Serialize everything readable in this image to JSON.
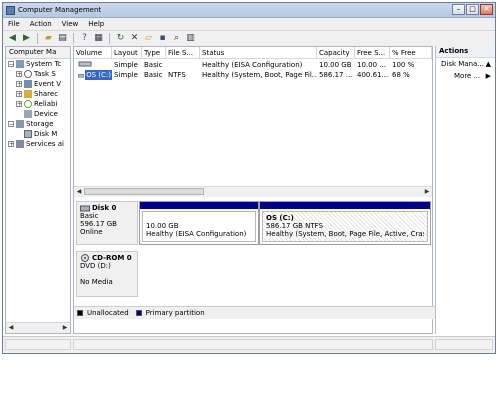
{
  "window": {
    "title": "Computer Management"
  },
  "menu": [
    "File",
    "Action",
    "View",
    "Help"
  ],
  "tree": {
    "header": "Computer Ma",
    "items": [
      {
        "label": "System Tc",
        "expander": "−"
      },
      {
        "label": "Task S",
        "expander": "+"
      },
      {
        "label": "Event V",
        "expander": "+"
      },
      {
        "label": "Sharec",
        "expander": "+"
      },
      {
        "label": "Reliabi",
        "expander": "+"
      },
      {
        "label": "Device",
        "expander": ""
      },
      {
        "label": "Storage",
        "expander": "−"
      },
      {
        "label": "Disk M",
        "expander": ""
      },
      {
        "label": "Services ai",
        "expander": "+"
      }
    ]
  },
  "volumes": {
    "columns": [
      "Volume",
      "Layout",
      "Type",
      "File S...",
      "Status",
      "Capacity",
      "Free S...",
      "% Free"
    ],
    "rows": [
      {
        "volume": "",
        "layout": "Simple",
        "type": "Basic",
        "fs": "",
        "status": "Healthy (EISA Configuration)",
        "capacity": "10.00 GB",
        "free": "10.00 ...",
        "pct": "100 %"
      },
      {
        "volume": "OS (C:)",
        "layout": "Simple",
        "type": "Basic",
        "fs": "NTFS",
        "status": "Healthy (System, Boot, Page Fil...",
        "capacity": "586.17 ...",
        "free": "400.61...",
        "pct": "68 %"
      }
    ]
  },
  "disks": [
    {
      "name": "Disk 0",
      "type": "Basic",
      "size": "596.17 GB",
      "state": "Online",
      "partitions": [
        {
          "name": "",
          "size": "10.00 GB",
          "status": "Healthy (EISA Configuration)"
        },
        {
          "name": "OS  (C:)",
          "size": "586.17 GB NTFS",
          "status": "Healthy (System, Boot, Page File, Active, Crash Du"
        }
      ]
    },
    {
      "name": "CD-ROM 0",
      "type": "DVD (D:)",
      "state": "No Media"
    }
  ],
  "legend": [
    {
      "label": "Unallocated",
      "color": "#000000"
    },
    {
      "label": "Primary partition",
      "color": "#00008b"
    }
  ],
  "actions": {
    "header": "Actions",
    "items": [
      {
        "label": "Disk Mana...",
        "caret": "▲"
      },
      {
        "label": "More ...",
        "caret": "▶"
      }
    ]
  },
  "colors": {
    "accent": "#00008b",
    "title_bar": "#c9d8ec"
  }
}
